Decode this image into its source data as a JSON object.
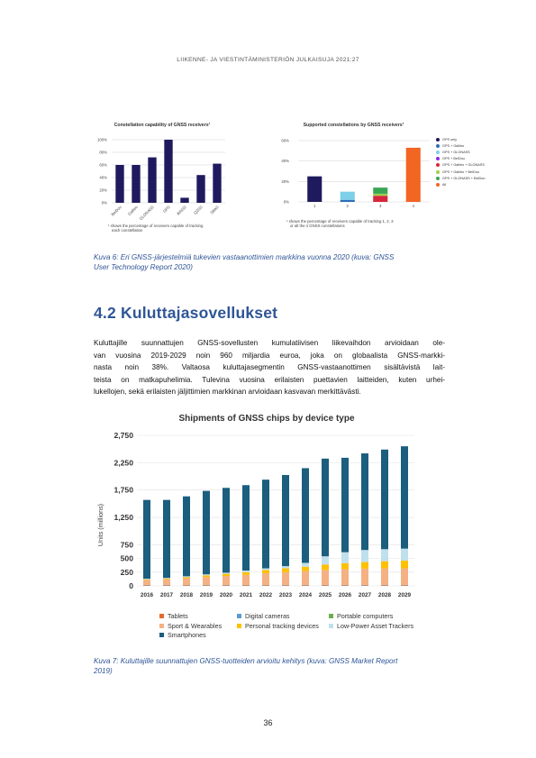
{
  "running_header": "LIIKENNE- JA VIESTINTÄMINISTERIÖN JULKAISUJA 2021:27",
  "figure6": {
    "left_chart": {
      "title": "Constellation capability of GNSS receivers¹",
      "footnote_lines": [
        "¹ shows the percentage of receivers capable of tracking",
        "each constellation"
      ]
    },
    "right_chart": {
      "title": "Supported constellations by GNSS receivers¹",
      "footnote_lines": [
        "¹ shows the percentage of receivers capable of tracking 1, 2, 3",
        "or all the 4 GNSS constellations"
      ]
    },
    "caption_lines": [
      "Kuva 6: Eri GNSS-järjestelmiä tukevien vastaanottimien markkina vuonna 2020 (kuva: GNSS",
      "User Technology Report 2020)"
    ]
  },
  "section": {
    "heading": "4.2 Kuluttajasovellukset",
    "paragraph_lines": [
      "Kuluttajille suunnattujen GNSS-sovellusten kumulatiivisen liikevaihdon arvioidaan ole-",
      "van vuosina 2019-2029 noin 960 miljardia euroa, joka on globaalista GNSS-markki-",
      "nasta noin 38%. Valtaosa kuluttajasegmentin GNSS-vastaanottimen sisältävistä lait-",
      "teista on matkapuhelimia. Tulevina vuosina erilaisten puettavien laitteiden, kuten urhei-",
      "lukellojen, sekä erilaisten jäljittimien markkinan arvioidaan kasvavan merkittävästi."
    ]
  },
  "figure7": {
    "caption_lines": [
      "Kuva 7: Kuluttajille suunnattujen GNSS-tuotteiden arvioitu kehitys (kuva: GNSS Market Report",
      "2019)"
    ]
  },
  "page_number": "36",
  "chart_data": [
    {
      "type": "bar",
      "title": "Constellation capability of GNSS receivers¹",
      "categories": [
        "BeiDou",
        "Galileo",
        "GLONASS",
        "GPS",
        "IRNSS",
        "QZSS",
        "SBAS"
      ],
      "values": [
        60,
        60,
        72,
        100,
        8,
        44,
        62
      ],
      "ylim": [
        0,
        100
      ],
      "yticks": [
        "0%",
        "20%",
        "40%",
        "60%",
        "80%",
        "100%"
      ],
      "grid": true,
      "color": "#1f1a5e"
    },
    {
      "type": "bar",
      "stacked": true,
      "title": "Supported constellations by GNSS receivers¹",
      "categories": [
        "1",
        "2",
        "3",
        "4"
      ],
      "ylim": [
        0,
        60
      ],
      "yticks": [
        "0%",
        "20%",
        "40%",
        "60%"
      ],
      "grid": true,
      "legend_position": "right",
      "series": [
        {
          "name": "GPS only",
          "color": "#1f1a5e",
          "values": [
            25,
            0,
            0,
            0
          ]
        },
        {
          "name": "GPS + Galileo",
          "color": "#2e6db4",
          "values": [
            0,
            2,
            0,
            0
          ]
        },
        {
          "name": "GPS + GLONASS",
          "color": "#7ecfe8",
          "values": [
            0,
            8,
            0,
            0
          ]
        },
        {
          "name": "GPS + BeiDou",
          "color": "#8a2be2",
          "values": [
            0,
            0,
            0,
            0
          ]
        },
        {
          "name": "GPS + Galileo + GLONASS",
          "color": "#d7263d",
          "values": [
            0,
            0,
            6,
            0
          ]
        },
        {
          "name": "GPS + Galileo + BeiDou",
          "color": "#9ccf4b",
          "values": [
            0,
            0,
            2,
            0
          ]
        },
        {
          "name": "GPS + GLONASS + BeiDou",
          "color": "#3aa655",
          "values": [
            0,
            0,
            6,
            0
          ]
        },
        {
          "name": "All",
          "color": "#f26522",
          "values": [
            0,
            0,
            0,
            53
          ]
        }
      ]
    },
    {
      "type": "bar",
      "stacked": true,
      "title": "Shipments of GNSS chips by device type",
      "ylabel": "Units (millions)",
      "categories": [
        "2016",
        "2017",
        "2018",
        "2019",
        "2020",
        "2021",
        "2022",
        "2023",
        "2024",
        "2025",
        "2026",
        "2027",
        "2028",
        "2029"
      ],
      "ylim": [
        0,
        2750
      ],
      "yticks": [
        "0",
        "250",
        "500",
        "750",
        "1,250",
        "1,750",
        "2,250",
        "2,750"
      ],
      "ytick_values": [
        0,
        250,
        500,
        750,
        1250,
        1750,
        2250,
        2750
      ],
      "grid": true,
      "legend_position": "bottom",
      "series": [
        {
          "name": "Tablets",
          "color": "#e8692c",
          "values": [
            12,
            12,
            12,
            12,
            12,
            12,
            12,
            12,
            12,
            12,
            12,
            12,
            12,
            12
          ]
        },
        {
          "name": "Digital cameras",
          "color": "#5b9bd5",
          "values": [
            5,
            5,
            5,
            5,
            5,
            5,
            5,
            5,
            5,
            5,
            5,
            5,
            5,
            5
          ]
        },
        {
          "name": "Portable computers",
          "color": "#70ad47",
          "values": [
            3,
            3,
            3,
            3,
            3,
            3,
            3,
            3,
            3,
            3,
            3,
            3,
            3,
            3
          ]
        },
        {
          "name": "Sport & Wearables",
          "color": "#f4b183",
          "values": [
            90,
            100,
            120,
            140,
            160,
            180,
            210,
            230,
            250,
            270,
            285,
            295,
            300,
            300
          ]
        },
        {
          "name": "Personal tracking devices",
          "color": "#ffc000",
          "values": [
            10,
            15,
            20,
            30,
            40,
            50,
            60,
            70,
            80,
            100,
            110,
            120,
            130,
            140
          ]
        },
        {
          "name": "Low-Power Asset Trackers",
          "color": "#bfe0ec",
          "values": [
            10,
            10,
            15,
            20,
            20,
            30,
            30,
            40,
            70,
            150,
            200,
            220,
            220,
            220
          ]
        },
        {
          "name": "Smartphones",
          "color": "#1b5e7e",
          "values": [
            1440,
            1425,
            1460,
            1525,
            1550,
            1560,
            1620,
            1665,
            1730,
            1785,
            1725,
            1765,
            1820,
            1870
          ]
        }
      ]
    }
  ]
}
